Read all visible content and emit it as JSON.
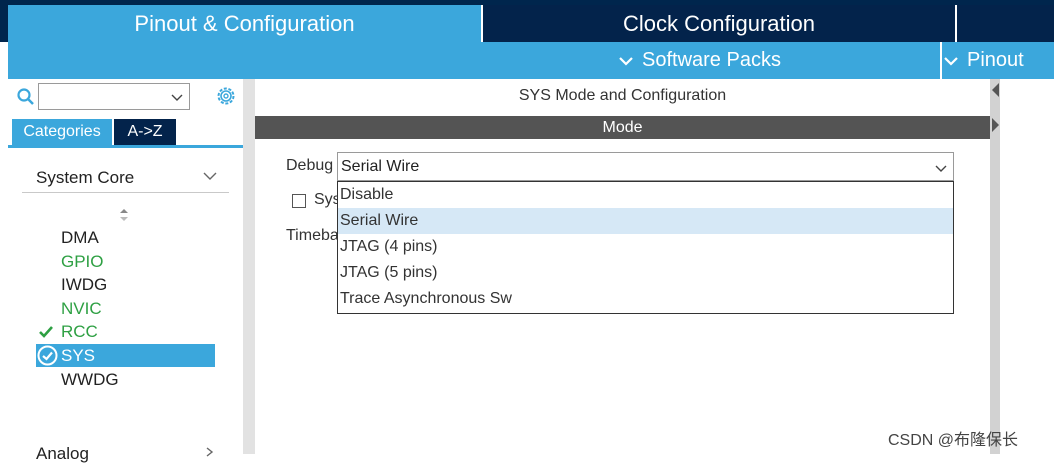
{
  "top_tabs": {
    "pinout_config": "Pinout & Configuration",
    "clock_config": "Clock Configuration"
  },
  "sub_menu": {
    "software_packs": "Software Packs",
    "pinout": "Pinout"
  },
  "left": {
    "search": {
      "value": ""
    },
    "tabs": {
      "categories": "Categories",
      "az": "A->Z"
    },
    "group": "System Core",
    "items": [
      {
        "label": "DMA",
        "state": "default"
      },
      {
        "label": "GPIO",
        "state": "configured"
      },
      {
        "label": "IWDG",
        "state": "default"
      },
      {
        "label": "NVIC",
        "state": "configured"
      },
      {
        "label": "RCC",
        "state": "checked"
      },
      {
        "label": "SYS",
        "state": "selected"
      },
      {
        "label": "WWDG",
        "state": "default"
      }
    ],
    "next_group": "Analog"
  },
  "main": {
    "title": "SYS Mode and Configuration",
    "mode_bar": "Mode",
    "debug_label": "Debug",
    "debug_value": "Serial Wire",
    "sys_checkbox_label": "Sys",
    "timebase_label": "Timeba",
    "dropdown_options": [
      "Disable",
      "Serial Wire",
      "JTAG (4 pins)",
      "JTAG (5 pins)",
      "Trace Asynchronous Sw"
    ],
    "highlighted_option": "Serial Wire"
  },
  "watermark": "CSDN @布隆保长",
  "colors": {
    "accent": "#3ba7dc",
    "navy": "#03234b",
    "configured_green": "#2ea043"
  }
}
